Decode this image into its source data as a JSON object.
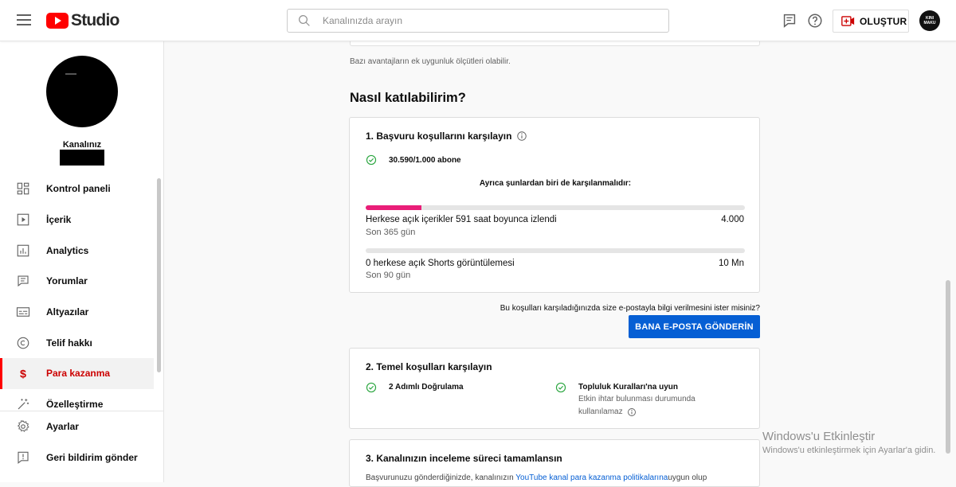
{
  "app": {
    "logo_text": "Studio"
  },
  "search": {
    "placeholder": "Kanalınızda arayın"
  },
  "toolbar": {
    "create_label": "OLUŞTUR",
    "avatar_text": "KINI MAKU"
  },
  "channel": {
    "label": "Kanalınız"
  },
  "sidebar": {
    "items": [
      {
        "label": "Kontrol paneli",
        "icon": "dashboard-icon",
        "active": false
      },
      {
        "label": "İçerik",
        "icon": "content-icon",
        "active": false
      },
      {
        "label": "Analytics",
        "icon": "analytics-icon",
        "active": false
      },
      {
        "label": "Yorumlar",
        "icon": "comments-icon",
        "active": false
      },
      {
        "label": "Altyazılar",
        "icon": "subtitles-icon",
        "active": false
      },
      {
        "label": "Telif hakkı",
        "icon": "copyright-icon",
        "active": false
      },
      {
        "label": "Para kazanma",
        "icon": "dollar-icon",
        "active": true
      },
      {
        "label": "Özelleştirme",
        "icon": "magic-wand-icon",
        "active": false
      }
    ],
    "bottom": [
      {
        "label": "Ayarlar",
        "icon": "gear-icon"
      },
      {
        "label": "Geri bildirim gönder",
        "icon": "feedback-icon"
      }
    ]
  },
  "main": {
    "benefit_note": "Bazı avantajların ek uygunluk ölçütleri olabilir.",
    "section_title": "Nasıl katılabilirim?",
    "step1": {
      "title": "1. Başvuru koşullarını karşılayın",
      "subscribers": "30.590/1.000 abone",
      "also_required": "Ayrıca şunlardan biri de karşılanmalıdır:",
      "metric1": {
        "label": "Herkese açık içerikler 591 saat boyunca izlendi",
        "period": "Son 365 gün",
        "target": "4.000",
        "progress": 0.148
      },
      "metric2": {
        "label": "0 herkese açık Shorts görüntülemesi",
        "period": "Son 90 gün",
        "target": "10 Mn",
        "progress": 0
      }
    },
    "email_question": "Bu koşulları karşıladığınızda size e-postayla bilgi verilmesini ister misiniz?",
    "email_button": "BANA E-POSTA GÖNDERİN",
    "step2": {
      "title": "2. Temel koşulları karşılayın",
      "req1": "2 Adımlı Doğrulama",
      "req2": "Topluluk Kuralları'na uyun",
      "req2_sub_line1": "Etkin ihtar bulunması durumunda",
      "req2_sub_line2": "kullanılamaz"
    },
    "step3": {
      "title": "3. Kanalınızın inceleme süreci tamamlansın",
      "desc_prefix": "Başvurunuzu gönderdiğinizde, kanalınızın ",
      "desc_link": "YouTube kanal para kazanma politikalarına",
      "desc_suffix": "uygun olup"
    }
  },
  "watermark": {
    "title": "Windows'u Etkinleştir",
    "subtitle": "Windows'u etkinleştirmek için Ayarlar'a gidin."
  },
  "colors": {
    "accent_red": "#ff0000",
    "active_text": "#cc0000",
    "progress_pink": "#e91e78",
    "button_blue": "#065fd4",
    "check_green": "#2ba640"
  }
}
